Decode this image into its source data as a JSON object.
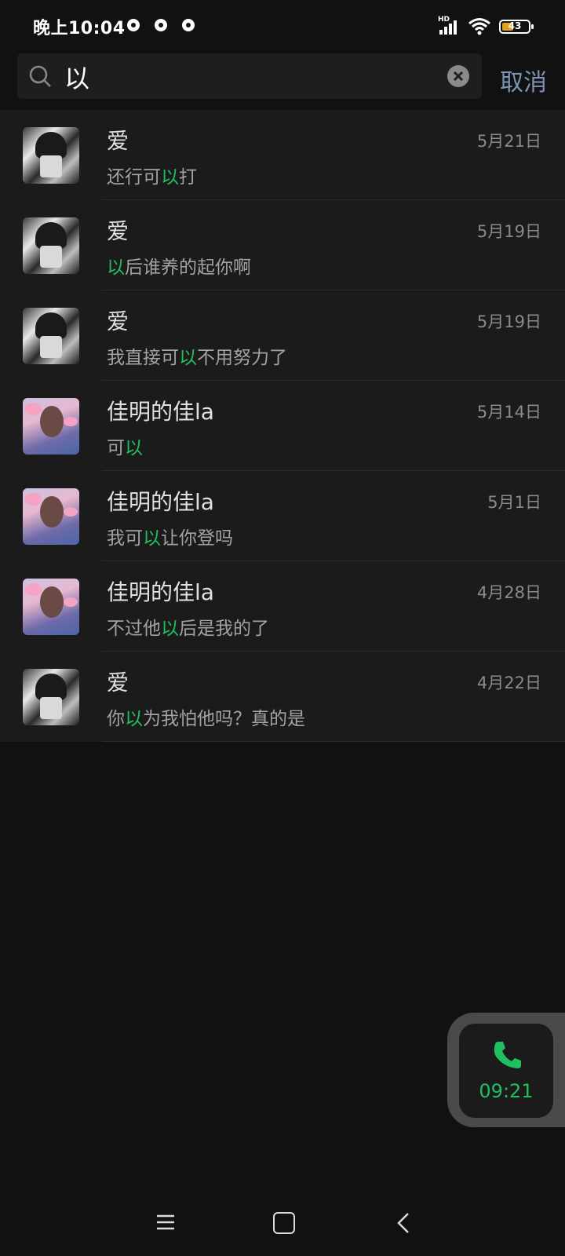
{
  "status_bar": {
    "time": "晚上10:04",
    "network_label": "HD",
    "battery_level": "43",
    "battery_percent": 43
  },
  "search": {
    "query": "以",
    "placeholder": "",
    "cancel_label": "取消"
  },
  "results": [
    {
      "name": "爱",
      "date": "5月21日",
      "avatar": "dark",
      "snippet": {
        "before": "还行可",
        "match": "以",
        "after": "打"
      }
    },
    {
      "name": "爱",
      "date": "5月19日",
      "avatar": "dark",
      "snippet": {
        "before": "",
        "match": "以",
        "after": "后谁养的起你啊"
      }
    },
    {
      "name": "爱",
      "date": "5月19日",
      "avatar": "dark",
      "snippet": {
        "before": "我直接可",
        "match": "以",
        "after": "不用努力了"
      }
    },
    {
      "name": "佳明的佳la",
      "date": "5月14日",
      "avatar": "pink",
      "snippet": {
        "before": "可",
        "match": "以",
        "after": ""
      }
    },
    {
      "name": "佳明的佳la",
      "date": "5月1日",
      "avatar": "pink",
      "snippet": {
        "before": "我可",
        "match": "以",
        "after": "让你登吗"
      }
    },
    {
      "name": "佳明的佳la",
      "date": "4月28日",
      "avatar": "pink",
      "snippet": {
        "before": "不过他",
        "match": "以",
        "after": "后是我的了"
      }
    },
    {
      "name": "爱",
      "date": "4月22日",
      "avatar": "dark",
      "snippet": {
        "before": "你",
        "match": "以",
        "after": "为我怕他吗？真的是"
      }
    }
  ],
  "call_floating": {
    "duration": "09:21",
    "icon": "phone-icon"
  },
  "colors": {
    "highlight": "#20c060",
    "cancel": "#7d93b5",
    "background": "#111111",
    "row_background": "#1b1b1b"
  }
}
